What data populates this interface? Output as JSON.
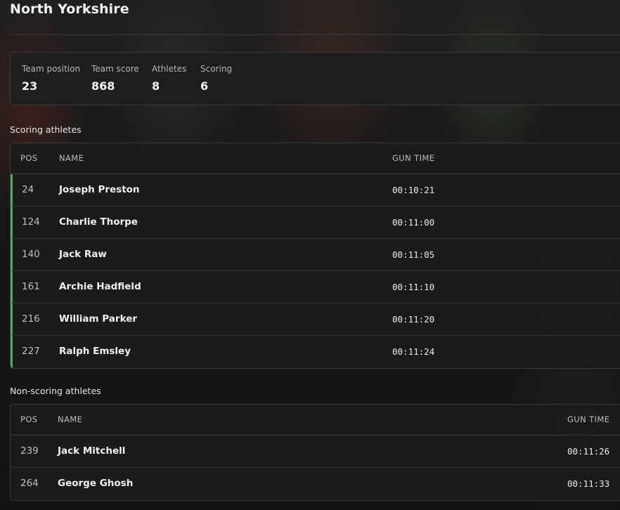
{
  "page": {
    "title": "North Yorkshire"
  },
  "stats": [
    {
      "label": "Team position",
      "value": "23"
    },
    {
      "label": "Team score",
      "value": "868"
    },
    {
      "label": "Athletes",
      "value": "8"
    },
    {
      "label": "Scoring",
      "value": "6"
    }
  ],
  "scoring": {
    "heading": "Scoring athletes",
    "columns": {
      "pos": "POS",
      "name": "NAME",
      "gun_time": "GUN TIME"
    },
    "rows": [
      {
        "pos": "24",
        "name": "Joseph Preston",
        "gun_time": "00:10:21"
      },
      {
        "pos": "124",
        "name": "Charlie Thorpe",
        "gun_time": "00:11:00"
      },
      {
        "pos": "140",
        "name": "Jack Raw",
        "gun_time": "00:11:05"
      },
      {
        "pos": "161",
        "name": "Archie Hadfield",
        "gun_time": "00:11:10"
      },
      {
        "pos": "216",
        "name": "William Parker",
        "gun_time": "00:11:20"
      },
      {
        "pos": "227",
        "name": "Ralph Emsley",
        "gun_time": "00:11:24"
      }
    ]
  },
  "non_scoring": {
    "heading": "Non-scoring athletes",
    "columns": {
      "pos": "POS",
      "name": "NAME",
      "gun_time": "GUN TIME"
    },
    "rows": [
      {
        "pos": "239",
        "name": "Jack Mitchell",
        "gun_time": "00:11:26"
      },
      {
        "pos": "264",
        "name": "George Ghosh",
        "gun_time": "00:11:33"
      }
    ]
  },
  "colors": {
    "scoring_indicator": "#33c13a",
    "card_background": "#1e1e1e",
    "border": "#3a3a3a"
  }
}
